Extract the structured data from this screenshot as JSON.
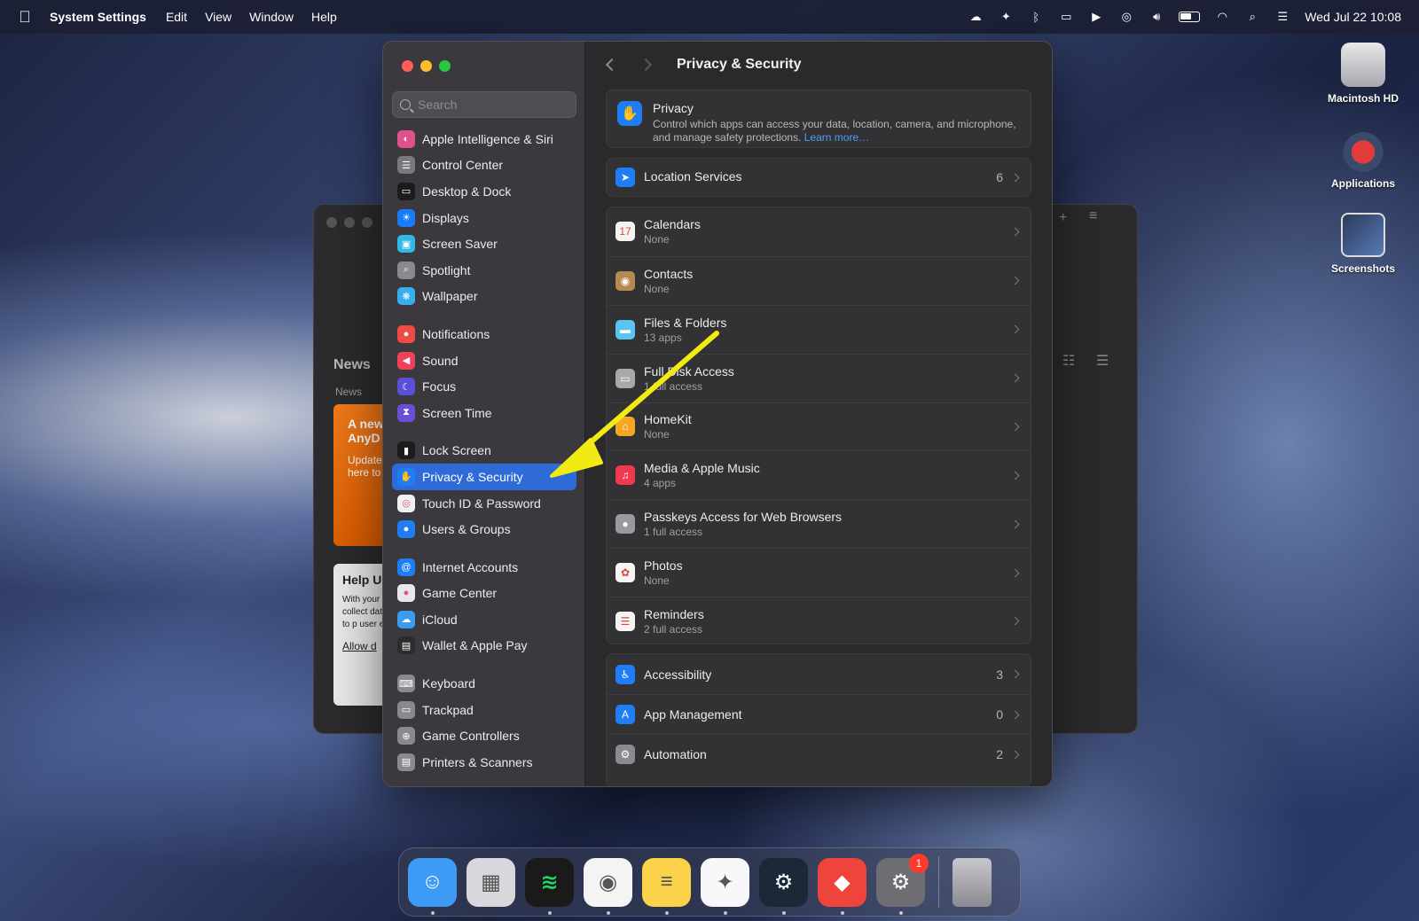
{
  "menubar": {
    "app_name": "System Settings",
    "menus": [
      "Edit",
      "View",
      "Window",
      "Help"
    ],
    "clock": "Wed Jul 22  10:08"
  },
  "desktop": {
    "icons": [
      "Macintosh HD",
      "Applications",
      "Screenshots"
    ]
  },
  "background_window": {
    "title": "News",
    "subtitle": "News",
    "promo_title": "A new AnyD",
    "promo_body": "Update here to",
    "help_title": "Help U",
    "help_body": "With your to collect data to p user exp",
    "help_link": "Allow d"
  },
  "settings": {
    "search_placeholder": "Search",
    "sidebar": {
      "groups": [
        [
          {
            "label": "Apple Intelligence & Siri",
            "icon": "siri-icon",
            "color": "#e0508a"
          },
          {
            "label": "Control Center",
            "icon": "control-center-icon",
            "color": "#7a7a7e"
          },
          {
            "label": "Desktop & Dock",
            "icon": "desktop-dock-icon",
            "color": "#1c1c1e"
          },
          {
            "label": "Displays",
            "icon": "displays-icon",
            "color": "#1a7cf5"
          },
          {
            "label": "Screen Saver",
            "icon": "screen-saver-icon",
            "color": "#31b8e6"
          },
          {
            "label": "Spotlight",
            "icon": "spotlight-icon",
            "color": "#8a8a8e"
          },
          {
            "label": "Wallpaper",
            "icon": "wallpaper-icon",
            "color": "#36aef0"
          }
        ],
        [
          {
            "label": "Notifications",
            "icon": "notifications-icon",
            "color": "#f04a44"
          },
          {
            "label": "Sound",
            "icon": "sound-icon",
            "color": "#f0405a"
          },
          {
            "label": "Focus",
            "icon": "focus-icon",
            "color": "#5a50d8"
          },
          {
            "label": "Screen Time",
            "icon": "screen-time-icon",
            "color": "#6a4fd6"
          }
        ],
        [
          {
            "label": "Lock Screen",
            "icon": "lock-icon",
            "color": "#1c1c1e"
          },
          {
            "label": "Privacy & Security",
            "icon": "privacy-hand-icon",
            "color": "#1f7ef6",
            "active": true
          },
          {
            "label": "Touch ID & Password",
            "icon": "fingerprint-icon",
            "color": "#f0f0f0"
          },
          {
            "label": "Users & Groups",
            "icon": "users-icon",
            "color": "#1f7ef6"
          }
        ],
        [
          {
            "label": "Internet Accounts",
            "icon": "at-icon",
            "color": "#1f7ef6"
          },
          {
            "label": "Game Center",
            "icon": "game-center-icon",
            "color": "#e8e8ea"
          },
          {
            "label": "iCloud",
            "icon": "icloud-icon",
            "color": "#3a9cf0"
          },
          {
            "label": "Wallet & Apple Pay",
            "icon": "wallet-icon",
            "color": "#2c2c2e"
          }
        ],
        [
          {
            "label": "Keyboard",
            "icon": "keyboard-icon",
            "color": "#8a8a8e"
          },
          {
            "label": "Trackpad",
            "icon": "trackpad-icon",
            "color": "#8a8a8e"
          },
          {
            "label": "Game Controllers",
            "icon": "game-controller-icon",
            "color": "#8a8a8e"
          },
          {
            "label": "Printers & Scanners",
            "icon": "printer-icon",
            "color": "#8a8a8e"
          }
        ]
      ]
    },
    "content": {
      "title": "Privacy & Security",
      "privacy": {
        "title": "Privacy",
        "description": "Control which apps can access your data, location, camera, and microphone, and manage safety protections.",
        "learn_more": "Learn more…"
      },
      "location": {
        "label": "Location Services",
        "count": "6"
      },
      "access_list": [
        {
          "label": "Calendars",
          "sub": "None",
          "icon": "calendar-icon",
          "color": "#f4f4f4",
          "glyph": "17"
        },
        {
          "label": "Contacts",
          "sub": "None",
          "icon": "contacts-icon",
          "color": "#b58a52",
          "glyph": "◉"
        },
        {
          "label": "Files & Folders",
          "sub": "13 apps",
          "icon": "folder-icon",
          "color": "#5ac4f0",
          "glyph": "▬"
        },
        {
          "label": "Full Disk Access",
          "sub": "1 full access",
          "icon": "disk-icon",
          "color": "#a8a8aa",
          "glyph": "▭"
        },
        {
          "label": "HomeKit",
          "sub": "None",
          "icon": "home-icon",
          "color": "#f5a623",
          "glyph": "⌂"
        },
        {
          "label": "Media & Apple Music",
          "sub": "4 apps",
          "icon": "music-icon",
          "color": "#f0384e",
          "glyph": "♫"
        },
        {
          "label": "Passkeys Access for Web Browsers",
          "sub": "1 full access",
          "icon": "passkey-icon",
          "color": "#9a9a9e",
          "glyph": "●"
        },
        {
          "label": "Photos",
          "sub": "None",
          "icon": "photos-icon",
          "color": "#f4f4f4",
          "glyph": "✿"
        },
        {
          "label": "Reminders",
          "sub": "2 full access",
          "icon": "reminders-icon",
          "color": "#f4f4f4",
          "glyph": "☰"
        }
      ],
      "bottom_list": [
        {
          "label": "Accessibility",
          "count": "3",
          "icon": "accessibility-icon",
          "color": "#1f7ef6",
          "glyph": "♿"
        },
        {
          "label": "App Management",
          "count": "0",
          "icon": "app-store-icon",
          "color": "#1f7ef6",
          "glyph": "A"
        },
        {
          "label": "Automation",
          "count": "2",
          "icon": "automation-gear-icon",
          "color": "#8a8a8e",
          "glyph": "⚙"
        }
      ]
    }
  },
  "dock": {
    "apps": [
      {
        "name": "finder",
        "color": "#3d9bf5",
        "glyph": "☺",
        "running": true
      },
      {
        "name": "launchpad",
        "color": "#d8d8dc",
        "glyph": "▦",
        "running": false
      },
      {
        "name": "spotify",
        "color": "#1a1a1a",
        "glyph": "≋",
        "running": true
      },
      {
        "name": "chrome",
        "color": "#f4f4f4",
        "glyph": "◉",
        "running": true
      },
      {
        "name": "notes",
        "color": "#fbd24a",
        "glyph": "≡",
        "running": true
      },
      {
        "name": "gemini",
        "color": "#f8f8fa",
        "glyph": "✦",
        "running": true
      },
      {
        "name": "steam",
        "color": "#1b2838",
        "glyph": "⚙",
        "running": true
      },
      {
        "name": "anydesk",
        "color": "#ef443b",
        "glyph": "◆",
        "running": true
      },
      {
        "name": "system-settings",
        "color": "#6e6e72",
        "glyph": "⚙",
        "running": true,
        "badge": "1"
      }
    ],
    "trash_color": "#c8c8cc"
  }
}
